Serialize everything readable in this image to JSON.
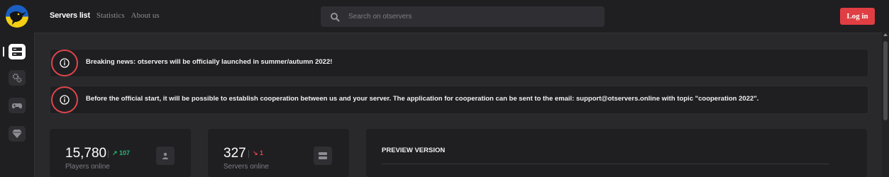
{
  "brand": {
    "logo_icon": "crow-on-ukraine-flag-logo",
    "colors": {
      "flag_blue": "#1b5fc2",
      "flag_yellow": "#f4cf13",
      "accent": "#e03e43",
      "up": "#2bb673",
      "down": "#e0454a"
    }
  },
  "sidebar": {
    "items": [
      {
        "icon": "servers-list-icon",
        "active": true
      },
      {
        "icon": "gears-icon",
        "active": false
      },
      {
        "icon": "gamepad-icon",
        "active": false
      },
      {
        "icon": "diamond-icon",
        "active": false
      }
    ]
  },
  "nav": {
    "items": [
      {
        "label": "Servers list",
        "active": true
      },
      {
        "label": "Statistics",
        "active": false
      },
      {
        "label": "About us",
        "active": false
      }
    ]
  },
  "search": {
    "placeholder": "Search on otservers",
    "value": "",
    "icon": "search-icon"
  },
  "login": {
    "label": "Log in"
  },
  "notices": [
    {
      "icon": "info-icon",
      "text": "Breaking news: otservers will be officially launched in summer/autumn 2022!"
    },
    {
      "icon": "info-icon",
      "text": "Before the official start, it will be possible to establish cooperation between us and your server. The application for cooperation can be sent to the email: support@otservers.online with topic \"cooperation 2022\"."
    }
  ],
  "stats": {
    "players": {
      "value": "15,780",
      "delta": "↗ 107",
      "label": "Players online",
      "icon": "user-icon"
    },
    "servers": {
      "value": "327",
      "delta": "↘ 1",
      "label": "Servers online",
      "icon": "server-icon"
    }
  },
  "preview": {
    "title": "PREVIEW VERSION"
  }
}
